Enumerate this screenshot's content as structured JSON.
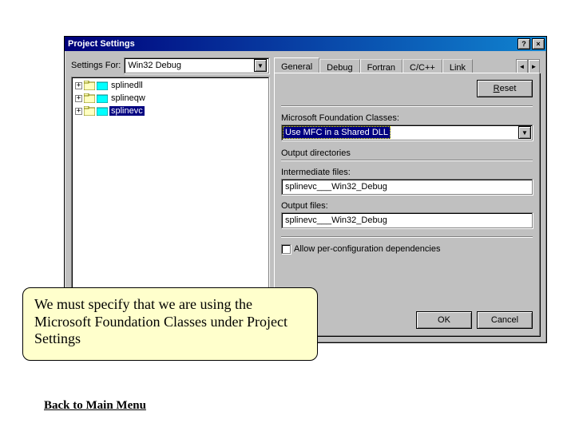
{
  "dialog": {
    "title": "Project Settings",
    "help_icon": "?",
    "close_icon": "×"
  },
  "left": {
    "settings_for_label": "Settings For:",
    "settings_for_value": "Win32 Debug",
    "tree_items": [
      {
        "label": "splinedll",
        "selected": false
      },
      {
        "label": "splineqw",
        "selected": false
      },
      {
        "label": "splinevc",
        "selected": true
      }
    ]
  },
  "tabs": {
    "items": [
      "General",
      "Debug",
      "Fortran",
      "C/C++",
      "Link"
    ],
    "active": 0
  },
  "general": {
    "reset_label": "Reset",
    "mfc_label": "Microsoft Foundation Classes:",
    "mfc_value": "Use MFC in a Shared DLL",
    "outdirs_label": "Output directories",
    "intermediate_label": "Intermediate files:",
    "intermediate_value": "splinevc___Win32_Debug",
    "output_label": "Output files:",
    "output_value": "splinevc___Win32_Debug",
    "perconfig_label": "Allow per-configuration dependencies"
  },
  "buttons": {
    "ok": "OK",
    "cancel": "Cancel"
  },
  "callout": {
    "text": "We must specify that we are using the Microsoft Foundation Classes under Project Settings"
  },
  "back_link": "Back to Main Menu"
}
